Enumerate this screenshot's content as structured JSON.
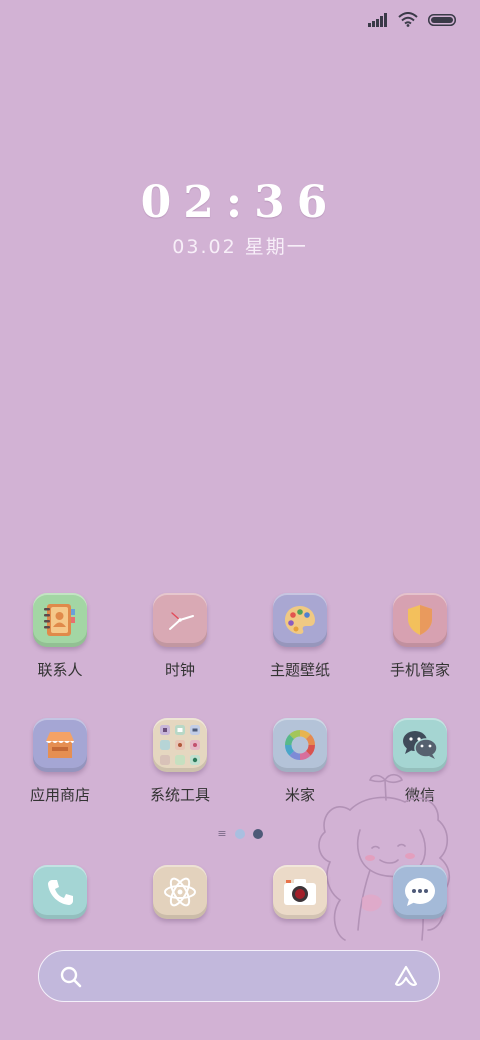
{
  "status_bar": {
    "signal_icon": "signal-bars-icon",
    "wifi_icon": "wifi-icon",
    "battery_icon": "battery-icon"
  },
  "clock": {
    "time": "02:36",
    "date": "03.02  星期一"
  },
  "apps_row1": [
    {
      "label": "联系人",
      "icon": "contacts-icon",
      "bg": "#a3d6a4"
    },
    {
      "label": "时钟",
      "icon": "clock-icon",
      "bg": "#d9a9b4"
    },
    {
      "label": "主题壁纸",
      "icon": "palette-icon",
      "bg": "#a9a7d2"
    },
    {
      "label": "手机管家",
      "icon": "shield-icon",
      "bg": "#d7a1b1"
    }
  ],
  "apps_row2": [
    {
      "label": "应用商店",
      "icon": "store-icon",
      "bg": "#a5a6d4"
    },
    {
      "label": "系统工具",
      "icon": "folder-icon",
      "bg": "#e5d7c0"
    },
    {
      "label": "米家",
      "icon": "mijia-icon",
      "bg": "#b4c3d8"
    },
    {
      "label": "微信",
      "icon": "wechat-icon",
      "bg": "#a5d5d2"
    }
  ],
  "page_indicator": {
    "menu_icon": "page-list-icon",
    "inactive_color": "#a9bfe0",
    "active_color": "#4e5a78"
  },
  "dock": [
    {
      "icon": "phone-icon",
      "bg": "#a4d5d4"
    },
    {
      "icon": "atom-icon",
      "bg": "#e3d2bd"
    },
    {
      "icon": "camera-icon",
      "bg": "#ebdac8"
    },
    {
      "icon": "message-icon",
      "bg": "#a4bad8"
    }
  ],
  "search_bar": {
    "search_icon": "search-icon",
    "assistant_icon": "assistant-logo-icon"
  },
  "wallpaper": {
    "decoration": "girl-doodle-illustration",
    "background": "#d2b2d4"
  }
}
